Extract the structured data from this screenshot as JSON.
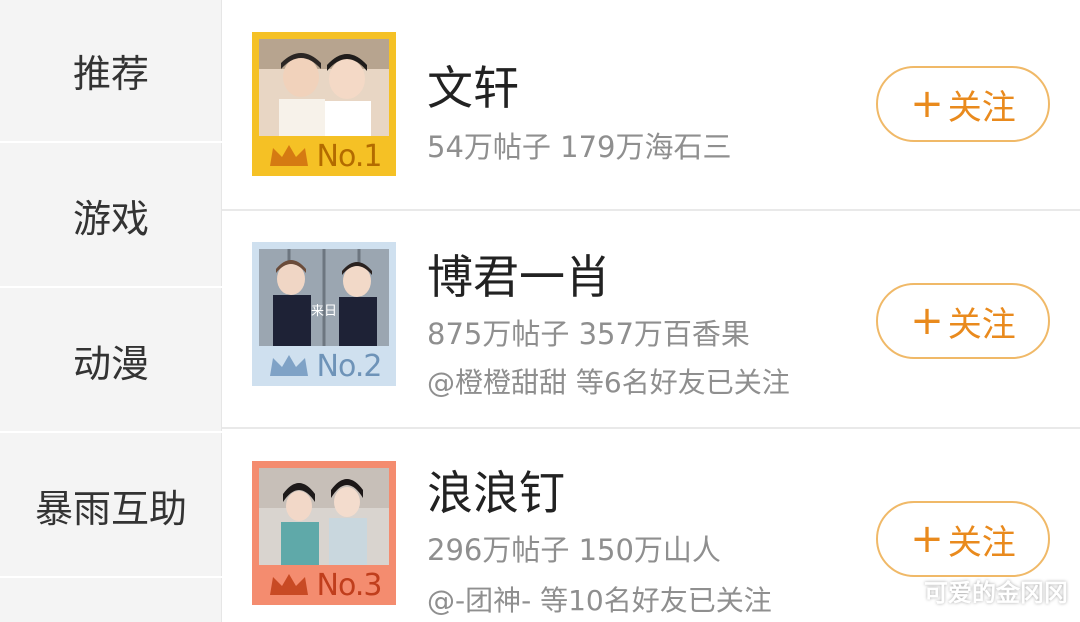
{
  "sidebar": {
    "items": [
      {
        "label": "推荐"
      },
      {
        "label": "游戏"
      },
      {
        "label": "动漫"
      },
      {
        "label": "暴雨互助"
      }
    ]
  },
  "list": {
    "rows": [
      {
        "name": "文轩",
        "stats": "54万帖子 179万海石三",
        "friends": "",
        "rank": "No.1",
        "follow_label": "关注",
        "follow_plus": "+"
      },
      {
        "name": "博君一肖",
        "stats": "875万帖子 357万百香果",
        "friends": "@橙橙甜甜 等6名好友已关注",
        "rank": "No.2",
        "follow_label": "关注",
        "follow_plus": "+"
      },
      {
        "name": "浪浪钉",
        "stats": "296万帖子 150万山人",
        "friends": "@-团神- 等10名好友已关注",
        "rank": "No.3",
        "follow_label": "关注",
        "follow_plus": "+"
      }
    ]
  },
  "watermark": "可爱的金冈冈",
  "colors": {
    "accent": "#e98a1d",
    "rank1": "#f5c125",
    "rank2": "#cfe0ef",
    "rank3": "#f48c6f"
  }
}
